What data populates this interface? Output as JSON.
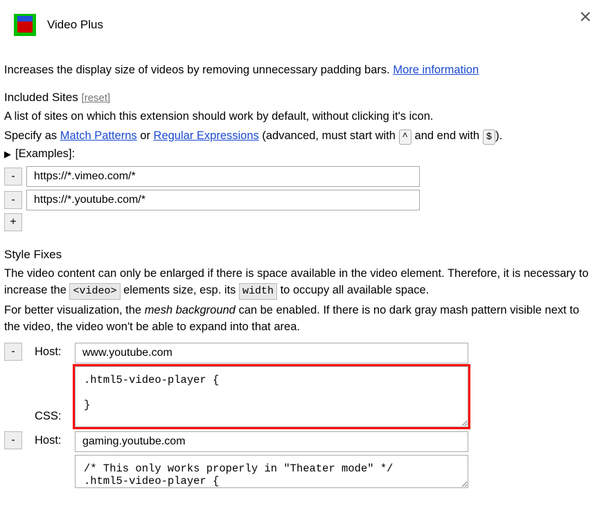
{
  "header": {
    "title": "Video Plus"
  },
  "description": {
    "text": "Increases the display size of videos by removing unnecessary padding bars.",
    "moreInfoLabel": "More information"
  },
  "includedSites": {
    "title": "Included Sites",
    "resetLabel": "[reset]",
    "help_line1": "A list of sites on which this extension should work by default, without clicking it's icon.",
    "help_line2_prefix": "Specify as ",
    "matchPatternsLabel": "Match Patterns",
    "help_or": " or ",
    "regexLabel": "Regular Expressions",
    "help_suffix1": " (advanced, must start with ",
    "key1": "^",
    "help_and": " and end with ",
    "key2": "$",
    "help_endparen": ").",
    "examplesLabel": "[Examples]:",
    "sites": [
      "https://*.vimeo.com/*",
      "https://*.youtube.com/*"
    ],
    "removeBtn": "-",
    "addBtn": "+"
  },
  "styleFixes": {
    "title": "Style Fixes",
    "help_p1_a": "The video content can only be enlarged if there is space available in the video element. Therefore, it is necessary to increase the ",
    "code_video": "<video>",
    "help_p1_b": " elements size, esp. its ",
    "code_width": "width",
    "help_p1_c": " to occupy all available space.",
    "help_p2_a": "For better visualization, the ",
    "italic_mesh": "mesh background",
    "help_p2_b": " can be enabled. If there is no dark gray mash pattern visible next to the video, the video won't be able to expand into that area.",
    "hostLabel": "Host:",
    "cssLabel": "CSS:",
    "removeBtn": "-",
    "fixes": [
      {
        "host": "www.youtube.com",
        "css": ".html5-video-player {\n\n}"
      },
      {
        "host": "gaming.youtube.com",
        "css": "/* This only works properly in \"Theater mode\" */\n.html5-video-player {"
      }
    ]
  }
}
